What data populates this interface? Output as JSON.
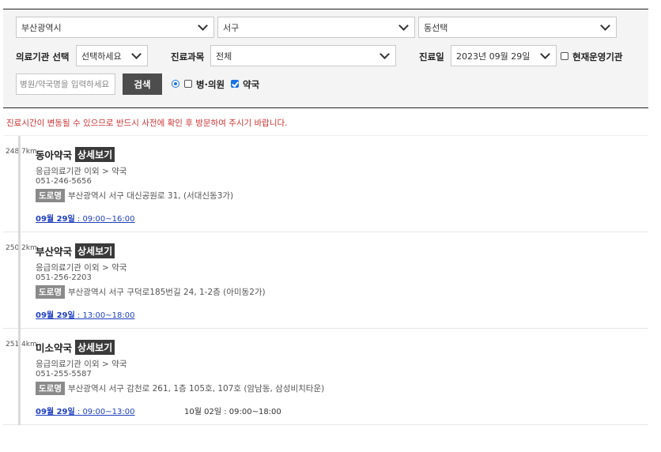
{
  "filters": {
    "city": "부산광역시",
    "district": "서구",
    "dong": "동선택",
    "institution_label": "의료기관 선택",
    "institution": "선택하세요",
    "department_label": "진료과목",
    "department": "전체",
    "date_label": "진료일",
    "date": "2023년 09월 29일",
    "open_now_label": "현재운영기관",
    "search_placeholder": "병원/약국명을 입력하세요",
    "search_button": "검색",
    "hospital_label": "병·의원",
    "pharmacy_label": "약국"
  },
  "notice": "진료시간이 변동될 수 있으므로 반드시 사전에 확인 후 방문하여 주시기 바랍니다.",
  "results": [
    {
      "distance": "248.7km",
      "name": "동아약국",
      "detail_label": "상세보기",
      "category": "응급의료기관 이외 > 약국",
      "phone": "051-246-5656",
      "road_label": "도로명",
      "address": "부산광역시 서구 대신공원로 31, (서대신동3가)",
      "hours_date": "09월 29일",
      "hours_time": " : 09:00~16:00",
      "hours2": ""
    },
    {
      "distance": "250.2km",
      "name": "부산약국",
      "detail_label": "상세보기",
      "category": "응급의료기관 이외 > 약국",
      "phone": "051-256-2203",
      "road_label": "도로명",
      "address": "부산광역시 서구 구덕로185번길 24, 1-2층 (아미동2가)",
      "hours_date": "09월 29일",
      "hours_time": " : 13:00~18:00",
      "hours2": ""
    },
    {
      "distance": "251.4km",
      "name": "미소약국",
      "detail_label": "상세보기",
      "category": "응급의료기관 이외 > 약국",
      "phone": "051-255-5587",
      "road_label": "도로명",
      "address": "부산광역시 서구 감천로 261, 1층 105호, 107호 (암남동, 삼성비치타운)",
      "hours_date": "09월 29일",
      "hours_time": " : 09:00~13:00",
      "hours2": "10월 02일 : 09:00~18:00"
    }
  ]
}
